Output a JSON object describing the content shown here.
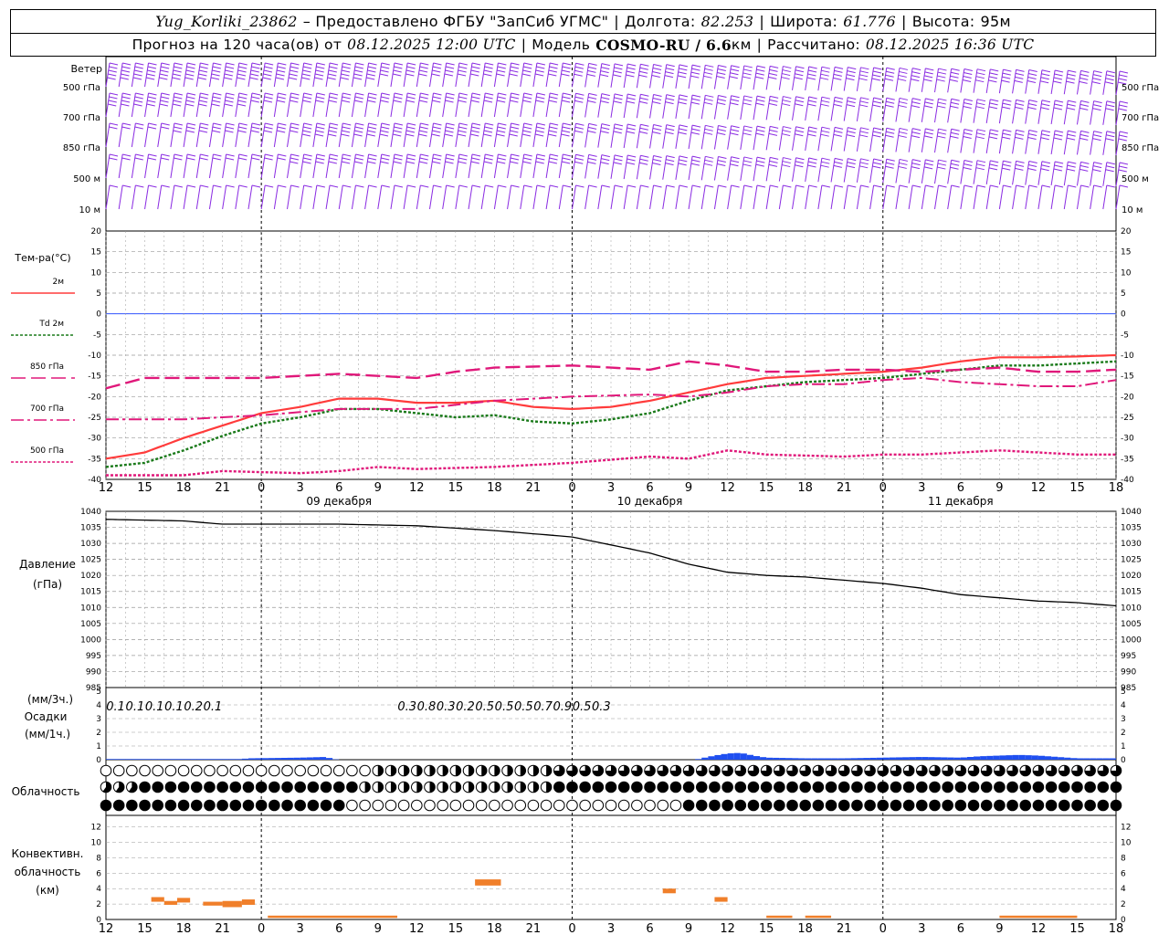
{
  "header": {
    "station": "Yug_Korliki_23862",
    "provider": "– Предоставлено ФГБУ \"ЗапСиб УГМС\"",
    "lon_label": "Долгота:",
    "lon": "82.253",
    "lat_label": "Широта:",
    "lat": "61.776",
    "alt_label": "Высота:",
    "alt": "95м"
  },
  "subheader": {
    "forecast_label": "Прогноз на 120 часа(ов) от",
    "forecast_from": "08.12.2025 12:00 UTC",
    "model_label": "Модель",
    "model": "COSMO-RU / 6.6",
    "model_unit": "км",
    "calc_label": "Рассчитано:",
    "calc": "08.12.2025 16:36 UTC"
  },
  "colors": {
    "wind": "#8a2be2",
    "t2m": "#ff3b3b",
    "td2m": "#1a7a1a",
    "t850": "#e0187a",
    "zero_line": "#3355ff",
    "pressure": "#000000",
    "precip": "#1f4ff0",
    "conv": "#f07f2a"
  },
  "time_axis": {
    "hour_labels": [
      "12",
      "15",
      "18",
      "21",
      "0",
      "3",
      "6",
      "9",
      "12",
      "15",
      "18",
      "21",
      "0",
      "3",
      "6",
      "9",
      "12",
      "15",
      "18",
      "21",
      "0",
      "3",
      "6",
      "9",
      "12",
      "15",
      "18"
    ],
    "day_labels": [
      "09 декабря",
      "10 декабря",
      "11 декабря"
    ]
  },
  "wind_panel": {
    "title": "Ветер",
    "levels": [
      "500 гПа",
      "700 гПа",
      "850 гПа",
      "500 м",
      "10 м"
    ]
  },
  "temp_panel": {
    "title": "Тем-ра(°C)",
    "legend": [
      {
        "label": "2м",
        "style": "solid"
      },
      {
        "label": "Td 2м",
        "style": "dotted-green"
      },
      {
        "label": "850 гПа",
        "style": "long-dash"
      },
      {
        "label": "700 гПа",
        "style": "dash-dot"
      },
      {
        "label": "500 гПа",
        "style": "dotted-pink"
      }
    ]
  },
  "pressure_panel": {
    "title": "Давление",
    "unit": "(гПа)"
  },
  "precip_panel": {
    "unit3": "(мм/3ч.)",
    "title": "Осадки",
    "unit1": "(мм/1ч.)",
    "labels_3h": [
      {
        "h": 3,
        "v": "0.1"
      },
      {
        "h": 9,
        "v": "0.1"
      },
      {
        "h": 15,
        "v": "0.1"
      },
      {
        "h": 21,
        "v": "0.1"
      },
      {
        "h": 27,
        "v": "0.2"
      },
      {
        "h": 33,
        "v": "0.1"
      },
      {
        "h": 93,
        "v": "0.3"
      },
      {
        "h": 99,
        "v": "0.8"
      },
      {
        "h": 105,
        "v": "0.3"
      },
      {
        "h": 111,
        "v": "0.2"
      },
      {
        "h": 117,
        "v": "0.5"
      },
      {
        "h": 123,
        "v": "0.5"
      },
      {
        "h": 129,
        "v": "0.5"
      },
      {
        "h": 135,
        "v": "0.7"
      },
      {
        "h": 141,
        "v": "0.9"
      },
      {
        "h": 147,
        "v": "0.5"
      },
      {
        "h": 153,
        "v": "0.3"
      }
    ]
  },
  "cloud_panel": {
    "title": "Облачность"
  },
  "conv_panel": {
    "title_1": "Конвективн.",
    "title_2": "облачность",
    "unit": "(км)"
  },
  "chart_data": [
    {
      "type": "barbs",
      "title": "Ветер",
      "x_hours": "0..156 step 1 (hours from 08.12 12 UTC)",
      "levels": [
        "500 гПа",
        "700 гПа",
        "850 гПа",
        "500 м",
        "10 м"
      ],
      "speed_kts_keypoints": {
        "500 гПа": [
          [
            0,
            50
          ],
          [
            40,
            45
          ],
          [
            70,
            40
          ],
          [
            100,
            35
          ],
          [
            156,
            35
          ]
        ],
        "700 гПа": [
          [
            0,
            40
          ],
          [
            40,
            30
          ],
          [
            70,
            30
          ],
          [
            100,
            30
          ],
          [
            156,
            30
          ]
        ],
        "850 гПа": [
          [
            0,
            20
          ],
          [
            40,
            40
          ],
          [
            70,
            35
          ],
          [
            100,
            30
          ],
          [
            156,
            30
          ]
        ],
        "500 м": [
          [
            0,
            15
          ],
          [
            40,
            30
          ],
          [
            70,
            30
          ],
          [
            100,
            25
          ],
          [
            156,
            25
          ]
        ],
        "10 м": [
          [
            0,
            5
          ],
          [
            40,
            10
          ],
          [
            70,
            10
          ],
          [
            100,
            10
          ],
          [
            156,
            10
          ]
        ]
      }
    },
    {
      "type": "line",
      "title": "Тем-ра(°C)",
      "ylim": [
        -40,
        20
      ],
      "yticks": [
        20,
        15,
        10,
        5,
        0,
        -5,
        -10,
        -15,
        -20,
        -25,
        -30,
        -35,
        -40
      ],
      "series": [
        {
          "name": "2м",
          "points": [
            [
              0,
              -35
            ],
            [
              6,
              -33.5
            ],
            [
              12,
              -30
            ],
            [
              18,
              -27
            ],
            [
              24,
              -24
            ],
            [
              30,
              -22.5
            ],
            [
              36,
              -20.5
            ],
            [
              42,
              -20.5
            ],
            [
              48,
              -21.5
            ],
            [
              54,
              -21.5
            ],
            [
              60,
              -21
            ],
            [
              66,
              -22.5
            ],
            [
              72,
              -23
            ],
            [
              78,
              -22.5
            ],
            [
              84,
              -21
            ],
            [
              90,
              -19
            ],
            [
              96,
              -17
            ],
            [
              102,
              -15.5
            ],
            [
              108,
              -15
            ],
            [
              114,
              -14.5
            ],
            [
              120,
              -14
            ],
            [
              126,
              -13
            ],
            [
              132,
              -11.5
            ],
            [
              138,
              -10.5
            ],
            [
              144,
              -10.5
            ],
            [
              150,
              -10.3
            ],
            [
              156,
              -10
            ]
          ]
        },
        {
          "name": "Td 2м",
          "points": [
            [
              0,
              -37
            ],
            [
              6,
              -36
            ],
            [
              12,
              -33
            ],
            [
              18,
              -29.5
            ],
            [
              24,
              -26.5
            ],
            [
              30,
              -25
            ],
            [
              36,
              -23
            ],
            [
              42,
              -23
            ],
            [
              48,
              -24
            ],
            [
              54,
              -25
            ],
            [
              60,
              -24.5
            ],
            [
              66,
              -26
            ],
            [
              72,
              -26.5
            ],
            [
              78,
              -25.5
            ],
            [
              84,
              -24
            ],
            [
              90,
              -21
            ],
            [
              96,
              -18.5
            ],
            [
              102,
              -17.5
            ],
            [
              108,
              -16.5
            ],
            [
              114,
              -16
            ],
            [
              120,
              -15.5
            ],
            [
              126,
              -14.5
            ],
            [
              132,
              -13.5
            ],
            [
              138,
              -12.5
            ],
            [
              144,
              -12.5
            ],
            [
              150,
              -12
            ],
            [
              156,
              -11.5
            ]
          ]
        },
        {
          "name": "850 гПа",
          "points": [
            [
              0,
              -18
            ],
            [
              6,
              -15.5
            ],
            [
              12,
              -15.5
            ],
            [
              24,
              -15.5
            ],
            [
              36,
              -14.5
            ],
            [
              48,
              -15.5
            ],
            [
              54,
              -14
            ],
            [
              60,
              -13
            ],
            [
              72,
              -12.5
            ],
            [
              84,
              -13.5
            ],
            [
              90,
              -11.5
            ],
            [
              96,
              -12.5
            ],
            [
              102,
              -14
            ],
            [
              108,
              -14
            ],
            [
              114,
              -13.5
            ],
            [
              120,
              -13.5
            ],
            [
              126,
              -14
            ],
            [
              132,
              -13.5
            ],
            [
              138,
              -13
            ],
            [
              144,
              -14
            ],
            [
              150,
              -14
            ],
            [
              156,
              -13.5
            ]
          ]
        },
        {
          "name": "700 гПа",
          "points": [
            [
              0,
              -25.5
            ],
            [
              12,
              -25.5
            ],
            [
              24,
              -24.5
            ],
            [
              36,
              -23
            ],
            [
              48,
              -23
            ],
            [
              60,
              -21
            ],
            [
              72,
              -20
            ],
            [
              84,
              -19.5
            ],
            [
              90,
              -20
            ],
            [
              96,
              -19
            ],
            [
              102,
              -17.5
            ],
            [
              108,
              -17
            ],
            [
              114,
              -17
            ],
            [
              120,
              -16
            ],
            [
              126,
              -15.5
            ],
            [
              132,
              -16.5
            ],
            [
              138,
              -17
            ],
            [
              144,
              -17.5
            ],
            [
              150,
              -17.5
            ],
            [
              156,
              -16
            ]
          ]
        },
        {
          "name": "500 гПа",
          "points": [
            [
              0,
              -39
            ],
            [
              12,
              -39
            ],
            [
              18,
              -38
            ],
            [
              30,
              -38.5
            ],
            [
              36,
              -38
            ],
            [
              42,
              -37
            ],
            [
              48,
              -37.5
            ],
            [
              60,
              -37
            ],
            [
              72,
              -36
            ],
            [
              84,
              -34.5
            ],
            [
              90,
              -35
            ],
            [
              96,
              -33
            ],
            [
              102,
              -34
            ],
            [
              114,
              -34.5
            ],
            [
              120,
              -34
            ],
            [
              126,
              -34
            ],
            [
              132,
              -33.5
            ],
            [
              138,
              -33
            ],
            [
              150,
              -34
            ],
            [
              156,
              -34
            ]
          ]
        }
      ]
    },
    {
      "type": "line",
      "title": "Давление",
      "ylabel": "(гПа)",
      "ylim": [
        985,
        1040
      ],
      "yticks": [
        1040,
        1035,
        1030,
        1025,
        1020,
        1015,
        1010,
        1005,
        1000,
        995,
        990,
        985
      ],
      "series": [
        {
          "name": "",
          "points": [
            [
              0,
              1037.5
            ],
            [
              12,
              1037
            ],
            [
              18,
              1036
            ],
            [
              24,
              1036
            ],
            [
              36,
              1036
            ],
            [
              48,
              1035.5
            ],
            [
              60,
              1034
            ],
            [
              72,
              1032
            ],
            [
              84,
              1027
            ],
            [
              90,
              1023.5
            ],
            [
              96,
              1021
            ],
            [
              102,
              1020
            ],
            [
              108,
              1019.5
            ],
            [
              114,
              1018.5
            ],
            [
              120,
              1017.5
            ],
            [
              126,
              1016
            ],
            [
              132,
              1014
            ],
            [
              138,
              1013
            ],
            [
              144,
              1012
            ],
            [
              150,
              1011.5
            ],
            [
              156,
              1010.5
            ]
          ]
        }
      ]
    },
    {
      "type": "bar",
      "title": "Осадки",
      "ylabel": "(мм/1ч.)",
      "ylim": [
        0,
        5
      ],
      "values_keypoints": [
        [
          0,
          0.05
        ],
        [
          12,
          0.05
        ],
        [
          21,
          0.05
        ],
        [
          22,
          0.1
        ],
        [
          30,
          0.15
        ],
        [
          34,
          0.2
        ],
        [
          35,
          0.05
        ],
        [
          36,
          0
        ],
        [
          91,
          0
        ],
        [
          92,
          0.1
        ],
        [
          94,
          0.3
        ],
        [
          96,
          0.45
        ],
        [
          98,
          0.5
        ],
        [
          100,
          0.3
        ],
        [
          102,
          0.15
        ],
        [
          108,
          0.1
        ],
        [
          114,
          0.1
        ],
        [
          120,
          0.15
        ],
        [
          126,
          0.2
        ],
        [
          132,
          0.15
        ],
        [
          135,
          0.25
        ],
        [
          138,
          0.3
        ],
        [
          141,
          0.35
        ],
        [
          144,
          0.3
        ],
        [
          147,
          0.2
        ],
        [
          150,
          0.1
        ],
        [
          156,
          0.1
        ]
      ]
    },
    {
      "type": "bar",
      "title": "Конвективн. облачность",
      "ylabel": "(км)",
      "ylim": [
        0,
        13
      ],
      "segments": [
        {
          "from": 7,
          "to": 9,
          "base": 2.3,
          "top": 2.9
        },
        {
          "from": 9,
          "to": 11,
          "base": 1.9,
          "top": 2.4
        },
        {
          "from": 11,
          "to": 13,
          "base": 2.2,
          "top": 2.8
        },
        {
          "from": 15,
          "to": 18,
          "base": 1.8,
          "top": 2.3
        },
        {
          "from": 18,
          "to": 21,
          "base": 1.6,
          "top": 2.4
        },
        {
          "from": 21,
          "to": 23,
          "base": 1.9,
          "top": 2.6
        },
        {
          "from": 25,
          "to": 45,
          "base": 0.2,
          "top": 0.5
        },
        {
          "from": 57,
          "to": 61,
          "base": 4.4,
          "top": 5.2
        },
        {
          "from": 86,
          "to": 88,
          "base": 3.4,
          "top": 4.0
        },
        {
          "from": 94,
          "to": 96,
          "base": 2.3,
          "top": 2.9
        },
        {
          "from": 102,
          "to": 106,
          "base": 0.2,
          "top": 0.5
        },
        {
          "from": 108,
          "to": 112,
          "base": 0.2,
          "top": 0.5
        },
        {
          "from": 138,
          "to": 150,
          "base": 0.2,
          "top": 0.5
        }
      ]
    }
  ]
}
